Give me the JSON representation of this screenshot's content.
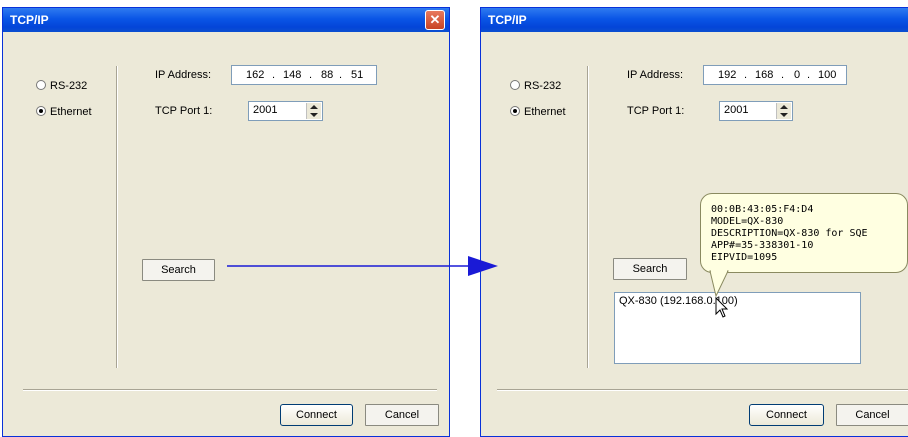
{
  "left_dialog": {
    "title": "TCP/IP",
    "close_glyph": "✕",
    "radio_rs232": "RS-232",
    "radio_ethernet": "Ethernet",
    "ip_label": "IP Address:",
    "ip_octets": [
      "162",
      "148",
      "88",
      "51"
    ],
    "port_label": "TCP Port 1:",
    "port_value": "2001",
    "search_label": "Search",
    "connect_label": "Connect",
    "cancel_label": "Cancel"
  },
  "right_dialog": {
    "title": "TCP/IP",
    "radio_rs232": "RS-232",
    "radio_ethernet": "Ethernet",
    "ip_label": "IP Address:",
    "ip_octets": [
      "192",
      "168",
      "0",
      "100"
    ],
    "port_label": "TCP Port 1:",
    "port_value": "2001",
    "search_label": "Search",
    "result_item": "QX-830 (192.168.0.100)",
    "connect_label": "Connect",
    "cancel_label": "Cancel"
  },
  "tooltip": {
    "lines": [
      "00:0B:43:05:F4:D4",
      "MODEL=QX-830",
      "DESCRIPTION=QX-830 for SQE",
      "APP#=35-338301-10",
      "EIPVID=1095"
    ]
  },
  "colors": {
    "titlebar": "#0a55e6",
    "dialog_bg": "#ece9d8",
    "arrow": "#1a1ad6",
    "tooltip_bg": "#ffffe1"
  },
  "icons": {
    "close": "close-icon",
    "arrow": "arrow-right-icon",
    "cursor": "mouse-pointer-icon"
  }
}
